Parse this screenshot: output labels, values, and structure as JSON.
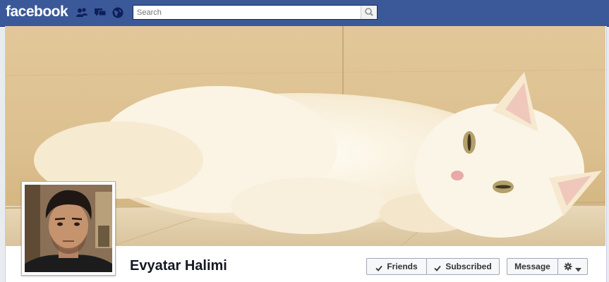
{
  "header": {
    "logo": "facebook",
    "search": {
      "placeholder": "Search",
      "value": ""
    },
    "jewels": [
      "friend-requests-icon",
      "messages-icon",
      "notifications-icon"
    ]
  },
  "profile": {
    "name": "Evyatar Halimi"
  },
  "actions": {
    "friends_label": "Friends",
    "subscribed_label": "Subscribed",
    "message_label": "Message"
  },
  "colors": {
    "brand": "#3b5998",
    "button_bg": "#f6f7f9"
  }
}
